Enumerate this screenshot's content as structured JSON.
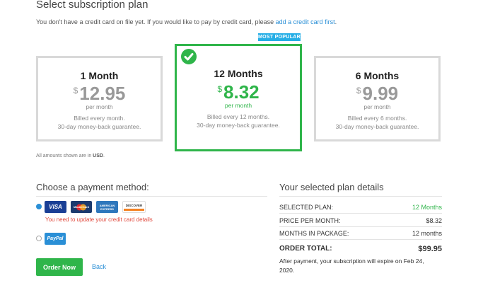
{
  "header": {
    "title": "Select subscription plan",
    "notice_text": "You don't have a credit card on file yet. If you would like to pay by credit card, please",
    "notice_link": "add a credit card first",
    "notice_end": "."
  },
  "badge": "MOST POPULAR",
  "plans": [
    {
      "name": "1 Month",
      "currency": "$",
      "price": "12.95",
      "per": "per month",
      "billed": "Billed every month.",
      "guarantee": "30-day money-back guarantee."
    },
    {
      "name": "12 Months",
      "currency": "$",
      "price": "8.32",
      "per": "per month",
      "billed": "Billed every 12 months.",
      "guarantee": "30-day money-back guarantee."
    },
    {
      "name": "6 Months",
      "currency": "$",
      "price": "9.99",
      "per": "per month",
      "billed": "Billed every 6 months.",
      "guarantee": "30-day money-back guarantee."
    }
  ],
  "amounts_note": "All amounts shown are in",
  "amounts_currency": "USD",
  "amounts_end": ".",
  "payment": {
    "title": "Choose a payment method:",
    "cards": [
      "VISA",
      "MasterCard",
      "AMERICAN EXPRESS",
      "DISCOVER"
    ],
    "card_error": "You need to update your credit card details",
    "paypal": "PayPal"
  },
  "actions": {
    "order": "Order Now",
    "back": "Back"
  },
  "details": {
    "title": "Your selected plan details",
    "rows": [
      {
        "label": "SELECTED PLAN:",
        "value": "12 Months"
      },
      {
        "label": "PRICE PER MONTH:",
        "value": "$8.32"
      },
      {
        "label": "MONTHS IN PACKAGE:",
        "value": "12 months"
      }
    ],
    "total_label": "ORDER TOTAL:",
    "total_value": "$99.95",
    "expiry_line1": "After payment, your subscription will expire on Feb 24,",
    "expiry_line2": "2020."
  },
  "colors": {
    "accent_green": "#2fb54a",
    "link_blue": "#2a8fd6",
    "badge_blue": "#25aee6",
    "error_red": "#e0463a"
  }
}
